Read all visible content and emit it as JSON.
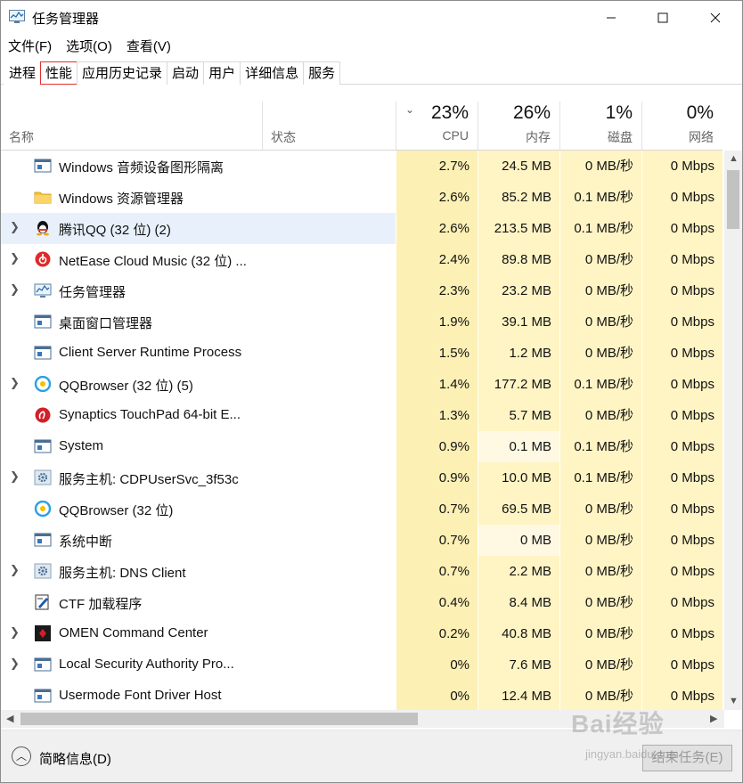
{
  "window": {
    "title": "任务管理器",
    "min": "—",
    "max": "☐",
    "close": "✕"
  },
  "menu": [
    "文件(F)",
    "选项(O)",
    "查看(V)"
  ],
  "tabs": [
    "进程",
    "性能",
    "应用历史记录",
    "启动",
    "用户",
    "详细信息",
    "服务"
  ],
  "header": {
    "name": "名称",
    "status": "状态",
    "cpu_pct": "23%",
    "cpu": "CPU",
    "mem_pct": "26%",
    "mem": "内存",
    "disk_pct": "1%",
    "disk": "磁盘",
    "net_pct": "0%",
    "net": "网络",
    "sort": "⌄"
  },
  "rows": [
    {
      "name": "Windows 音频设备图形隔离",
      "icon": "window-icon",
      "expand": false,
      "cpu": "2.7%",
      "mem": "24.5 MB",
      "disk": "0 MB/秒",
      "net": "0 Mbps"
    },
    {
      "name": "Windows 资源管理器",
      "icon": "folder-icon",
      "expand": false,
      "cpu": "2.6%",
      "mem": "85.2 MB",
      "disk": "0.1 MB/秒",
      "net": "0 Mbps"
    },
    {
      "name": "腾讯QQ (32 位) (2)",
      "icon": "qq-icon",
      "expand": true,
      "cpu": "2.6%",
      "mem": "213.5 MB",
      "disk": "0.1 MB/秒",
      "net": "0 Mbps",
      "selected": true
    },
    {
      "name": "NetEase Cloud Music (32 位) ...",
      "icon": "netease-icon",
      "expand": true,
      "cpu": "2.4%",
      "mem": "89.8 MB",
      "disk": "0 MB/秒",
      "net": "0 Mbps"
    },
    {
      "name": "任务管理器",
      "icon": "taskmgr-icon",
      "expand": true,
      "cpu": "2.3%",
      "mem": "23.2 MB",
      "disk": "0 MB/秒",
      "net": "0 Mbps"
    },
    {
      "name": "桌面窗口管理器",
      "icon": "window-icon",
      "expand": false,
      "cpu": "1.9%",
      "mem": "39.1 MB",
      "disk": "0 MB/秒",
      "net": "0 Mbps"
    },
    {
      "name": "Client Server Runtime Process",
      "icon": "window-icon",
      "expand": false,
      "cpu": "1.5%",
      "mem": "1.2 MB",
      "disk": "0 MB/秒",
      "net": "0 Mbps"
    },
    {
      "name": "QQBrowser (32 位) (5)",
      "icon": "qqbrowser-icon",
      "expand": true,
      "cpu": "1.4%",
      "mem": "177.2 MB",
      "disk": "0.1 MB/秒",
      "net": "0 Mbps"
    },
    {
      "name": "Synaptics TouchPad 64-bit E...",
      "icon": "synaptics-icon",
      "expand": false,
      "cpu": "1.3%",
      "mem": "5.7 MB",
      "disk": "0 MB/秒",
      "net": "0 Mbps"
    },
    {
      "name": "System",
      "icon": "window-icon",
      "expand": false,
      "cpu": "0.9%",
      "mem": "0.1 MB",
      "disk": "0.1 MB/秒",
      "net": "0 Mbps"
    },
    {
      "name": "服务主机: CDPUserSvc_3f53c",
      "icon": "gear-icon",
      "expand": true,
      "cpu": "0.9%",
      "mem": "10.0 MB",
      "disk": "0.1 MB/秒",
      "net": "0 Mbps"
    },
    {
      "name": "QQBrowser (32 位)",
      "icon": "qqbrowser-icon",
      "expand": false,
      "cpu": "0.7%",
      "mem": "69.5 MB",
      "disk": "0 MB/秒",
      "net": "0 Mbps"
    },
    {
      "name": "系统中断",
      "icon": "window-icon",
      "expand": false,
      "cpu": "0.7%",
      "mem": "0 MB",
      "disk": "0 MB/秒",
      "net": "0 Mbps"
    },
    {
      "name": "服务主机: DNS Client",
      "icon": "gear-icon",
      "expand": true,
      "cpu": "0.7%",
      "mem": "2.2 MB",
      "disk": "0 MB/秒",
      "net": "0 Mbps"
    },
    {
      "name": "CTF 加载程序",
      "icon": "ctf-icon",
      "expand": false,
      "cpu": "0.4%",
      "mem": "8.4 MB",
      "disk": "0 MB/秒",
      "net": "0 Mbps"
    },
    {
      "name": "OMEN Command Center",
      "icon": "omen-icon",
      "expand": true,
      "cpu": "0.2%",
      "mem": "40.8 MB",
      "disk": "0 MB/秒",
      "net": "0 Mbps"
    },
    {
      "name": "Local Security Authority Pro...",
      "icon": "window-icon",
      "expand": true,
      "cpu": "0%",
      "mem": "7.6 MB",
      "disk": "0 MB/秒",
      "net": "0 Mbps"
    },
    {
      "name": "Usermode Font Driver Host",
      "icon": "window-icon",
      "expand": false,
      "cpu": "0%",
      "mem": "12.4 MB",
      "disk": "0 MB/秒",
      "net": "0 Mbps"
    }
  ],
  "footer": {
    "fewer_details": "简略信息(D)",
    "end_task": "结束任务(E)"
  },
  "watermark": {
    "logo": "Bai经验",
    "url": "jingyan.baidu.com"
  }
}
